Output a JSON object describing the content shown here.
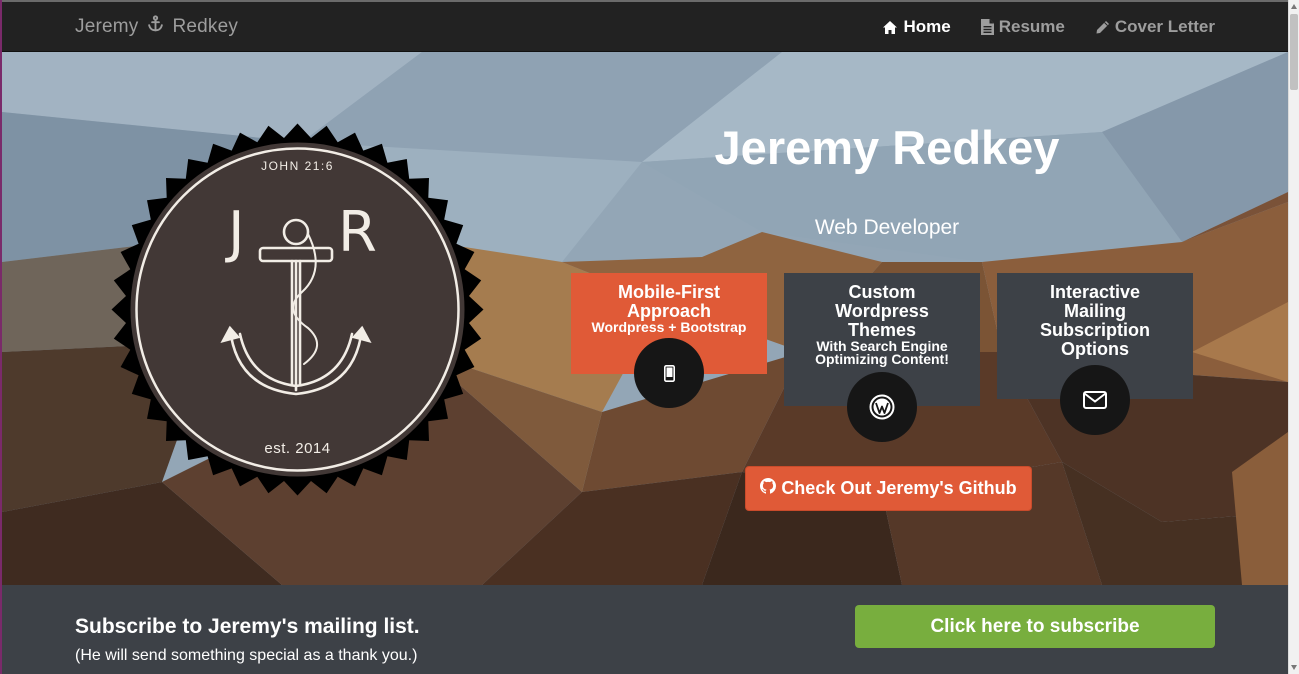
{
  "nav": {
    "brand_first": "Jeremy",
    "brand_last": "Redkey",
    "items": [
      {
        "label": "Home",
        "icon": "home-icon",
        "active": true
      },
      {
        "label": "Resume",
        "icon": "file-text-icon",
        "active": false
      },
      {
        "label": "Cover Letter",
        "icon": "pencil-icon",
        "active": false
      }
    ]
  },
  "logo": {
    "verse": "JOHN 21:6",
    "initial_left": "J",
    "initial_right": "R",
    "established": "est. 2014"
  },
  "hero": {
    "title": "Jeremy Redkey",
    "subtitle": "Web Developer",
    "features": [
      {
        "title": "Mobile-First Approach",
        "sub": "Wordpress + Bootstrap",
        "icon": "mobile-phone-icon",
        "color": "#e05a37"
      },
      {
        "title": "Custom Wordpress Themes",
        "sub": "With Search Engine Optimizing Content!",
        "icon": "wordpress-icon",
        "color": "#3d4147"
      },
      {
        "title": "Interactive Mailing Subscription Options",
        "sub": "",
        "icon": "envelope-icon",
        "color": "#3d4147"
      }
    ],
    "github_button": "Check Out Jeremy's Github"
  },
  "subscribe": {
    "heading": "Subscribe to Jeremy's mailing list.",
    "note": "(He will send something special as a thank you.)",
    "button": "Click here to subscribe",
    "button_color": "#78ae3e"
  },
  "colors": {
    "navbar": "#222222",
    "accent": "#e05a37",
    "panel": "#3d4147"
  }
}
